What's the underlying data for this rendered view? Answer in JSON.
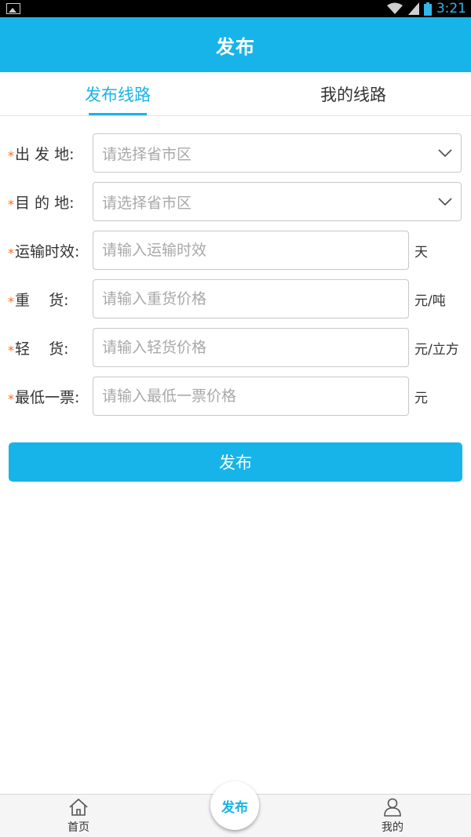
{
  "status_bar": {
    "time": "3:21"
  },
  "header": {
    "title": "发布"
  },
  "tabs": [
    {
      "label": "发布线路",
      "active": true
    },
    {
      "label": "我的线路",
      "active": false
    }
  ],
  "form": {
    "required_mark": "*",
    "rows": [
      {
        "label": "出 发 地:",
        "placeholder": "请选择省市区",
        "type": "select",
        "unit": ""
      },
      {
        "label": "目 的 地:",
        "placeholder": "请选择省市区",
        "type": "select",
        "unit": ""
      },
      {
        "label": "运输时效:",
        "placeholder": "请输入运输时效",
        "type": "input",
        "unit": "天"
      },
      {
        "label": "重    货:",
        "placeholder": "请输入重货价格",
        "type": "input",
        "unit": "元/吨"
      },
      {
        "label": "轻    货:",
        "placeholder": "请输入轻货价格",
        "type": "input",
        "unit": "元/立方"
      },
      {
        "label": "最低一票:",
        "placeholder": "请输入最低一票价格",
        "type": "input",
        "unit": "元"
      }
    ],
    "submit_label": "发布"
  },
  "bottom_nav": {
    "home_label": "首页",
    "center_label": "发布",
    "mine_label": "我的"
  },
  "colors": {
    "accent": "#17b4e9",
    "required": "#ff6a1a"
  },
  "icons": {
    "home": "home-icon",
    "mine": "user-icon",
    "select": "chevron-down-icon"
  }
}
